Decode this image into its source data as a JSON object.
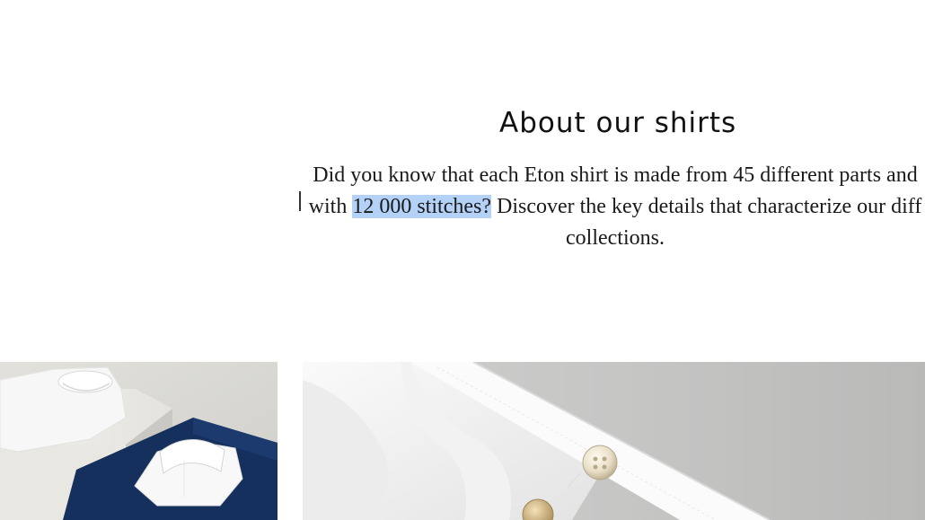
{
  "section": {
    "title": "About our shirts",
    "text_line1": "Did you know that each Eton shirt is made from 45 different parts and",
    "text_line2_before": "with ",
    "text_line2_highlight": "12 000 stitches?",
    "text_line2_after": " Discover the key details that characterize our diff",
    "text_line3": "collections."
  },
  "images": {
    "left": "folded-shirts-on-display-photo",
    "right": "shirt-cuff-with-pearl-button-photo"
  }
}
